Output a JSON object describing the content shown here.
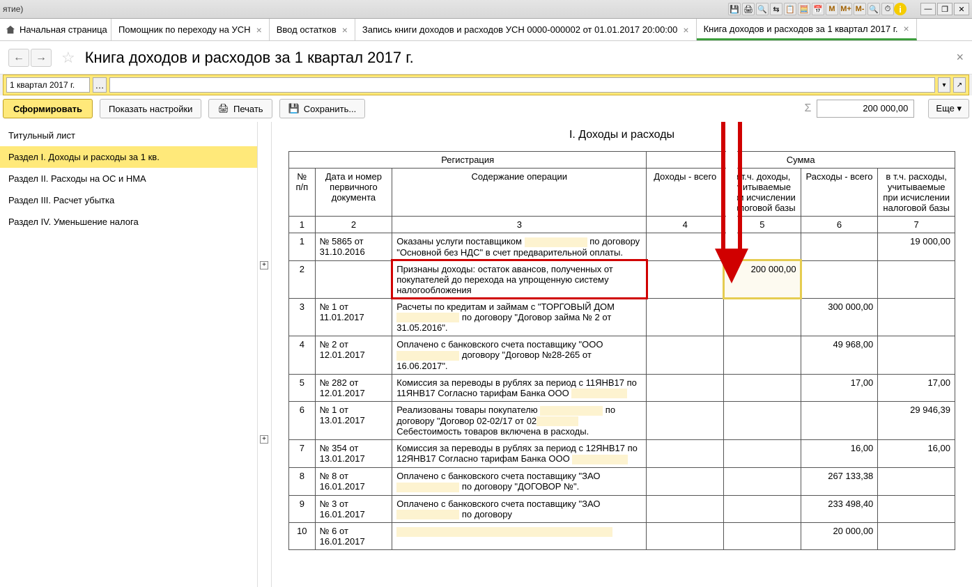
{
  "titlebar": {
    "left": "ятие)",
    "m": "M",
    "mplus": "M+",
    "mminus": "M-"
  },
  "tabs": {
    "home": "Начальная страница",
    "items": [
      "Помощник по переходу на УСН",
      "Ввод остатков",
      "Запись книги доходов и расходов УСН 0000-000002 от 01.01.2017 20:00:00",
      "Книга доходов и расходов за 1 квартал 2017 г."
    ]
  },
  "page": {
    "title": "Книга доходов и расходов за 1 квартал 2017 г.",
    "period": "1 квартал 2017 г."
  },
  "toolbar": {
    "form": "Сформировать",
    "settings": "Показать настройки",
    "print": "Печать",
    "save": "Сохранить...",
    "sum": "200 000,00",
    "more": "Еще"
  },
  "sidebar": [
    "Титульный лист",
    "Раздел I. Доходы и расходы за 1 кв.",
    "Раздел II. Расходы на ОС и НМА",
    "Раздел III. Расчет убытка",
    "Раздел IV. Уменьшение налога"
  ],
  "section_title": "I. Доходы и расходы",
  "headers": {
    "reg": "Регистрация",
    "sum": "Сумма",
    "n": "№ п/п",
    "doc": "Дата и номер первичного документа",
    "op": "Содержание операции",
    "c4": "Доходы - всего",
    "c5": "в т.ч. доходы, учитываемые при исчислении налоговой базы",
    "c6": "Расходы - всего",
    "c7": "в т.ч. расходы, учитываемые при исчислении налоговой базы",
    "nums": [
      "1",
      "2",
      "3",
      "4",
      "5",
      "6",
      "7"
    ]
  },
  "rows": [
    {
      "n": "1",
      "doc": "№ 5865 от 31.10.2016",
      "op_pre": "Оказаны услуги поставщиком ",
      "op_post": " по договору \"Основной без НДС\" в счет предварительной оплаты.",
      "c7": "19 000,00"
    },
    {
      "n": "2",
      "doc": "",
      "op": "Признаны доходы: остаток авансов, полученных от покупателей до перехода на упрощенную систему налогообложения",
      "c5": "200 000,00",
      "highlight": true
    },
    {
      "n": "3",
      "doc": "№ 1 от 11.01.2017",
      "op_pre": "Расчеты по кредитам и займам с \"ТОРГОВЫЙ ДОМ ",
      "op_post": " по договору \"Договор займа № 2 от 31.05.2016\".",
      "c6": "300 000,00"
    },
    {
      "n": "4",
      "doc": "№ 2 от 12.01.2017",
      "op_pre": "Оплачено с банковского счета поставщику \"ООО ",
      "op_mid": " договору \"Договор №28-265 от 16.06.2017\".",
      "c6": "49 968,00"
    },
    {
      "n": "5",
      "doc": "№ 282 от 12.01.2017",
      "op": "Комиссия за переводы в рублях за период с 11ЯНВ17 по 11ЯНВ17 Согласно тарифам Банка ООО ",
      "c6": "17,00",
      "c7": "17,00"
    },
    {
      "n": "6",
      "doc": "№ 1 от 13.01.2017",
      "op_pre": "Реализованы товары покупателю ",
      "op_post": " по договору \"Договор 02-02/17 от 02",
      "op_end": " Себестоимость товаров включена в расходы.",
      "c7": "29 946,39"
    },
    {
      "n": "7",
      "doc": "№ 354 от 13.01.2017",
      "op": "Комиссия за переводы в рублях за период с 12ЯНВ17 по 12ЯНВ17 Согласно тарифам Банка ООО ",
      "c6": "16,00",
      "c7": "16,00"
    },
    {
      "n": "8",
      "doc": "№ 8 от 16.01.2017",
      "op_pre": "Оплачено с банковского счета поставщику \"ЗАО ",
      "op_post": " по договору \"ДОГОВОР №\".",
      "c6": "267 133,38"
    },
    {
      "n": "9",
      "doc": "№ 3 от 16.01.2017",
      "op_pre": "Оплачено с банковского счета поставщику \"ЗАО ",
      "op_post": " по договору ",
      "c6": "233 498,40"
    },
    {
      "n": "10",
      "doc": "№ 6 от 16.01.2017",
      "op": "",
      "c6": "20 000,00"
    }
  ]
}
